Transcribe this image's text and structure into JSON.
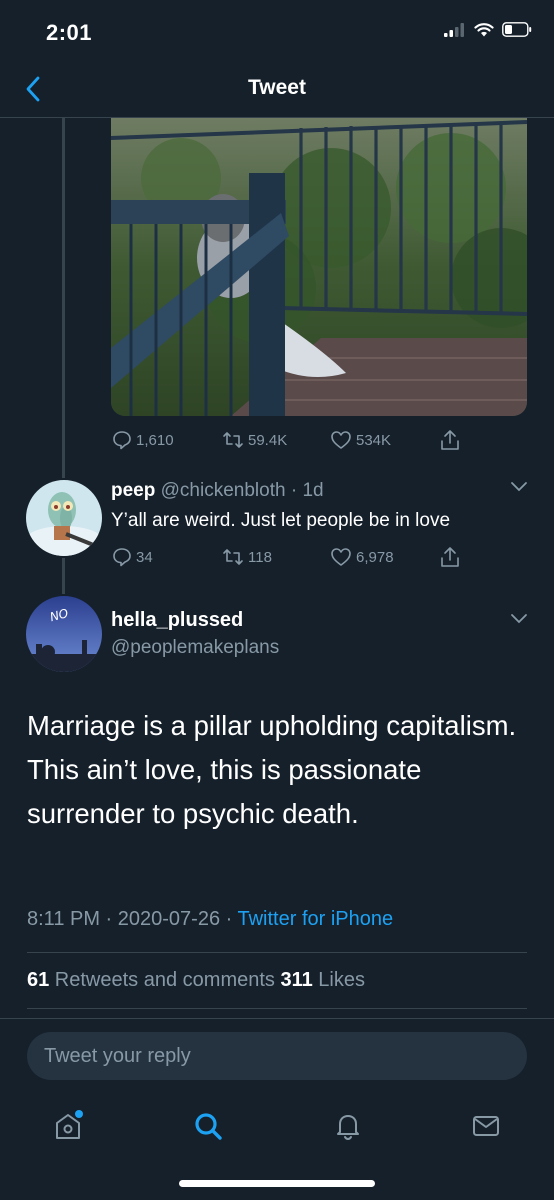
{
  "status_bar": {
    "time": "2:01"
  },
  "nav": {
    "title": "Tweet"
  },
  "parent_tweet": {
    "stats": {
      "replies": "1,610",
      "retweets": "59.4K",
      "likes": "534K"
    }
  },
  "reply_tweet": {
    "name": "peep",
    "handle": "@chickenbloth",
    "time": "· 1d",
    "text": "Y’all are weird. Just let people be in love",
    "stats": {
      "replies": "34",
      "retweets": "118",
      "likes": "6,978"
    }
  },
  "main_tweet": {
    "name": "hella_plussed",
    "handle": "@peoplemakeplans",
    "avatar_text": "NO",
    "text": "Marriage is a pillar upholding capitalism. This ain’t love, this is passionate surrender to psychic death.",
    "timestamp": "8:11 PM · 2020-07-26 · ",
    "source": "Twitter for iPhone",
    "retweet_count": "61",
    "retweet_label": " Retweets and comments  ",
    "like_count": "311",
    "like_label": " Likes"
  },
  "reply_box": {
    "placeholder": "Tweet your reply"
  },
  "colors": {
    "background": "#15202b",
    "accent": "#1da1f2",
    "muted": "#8899a6",
    "border": "#38444d"
  },
  "tab_bar": {
    "icons": [
      "home-icon",
      "search-icon",
      "notifications-icon",
      "messages-icon"
    ]
  }
}
